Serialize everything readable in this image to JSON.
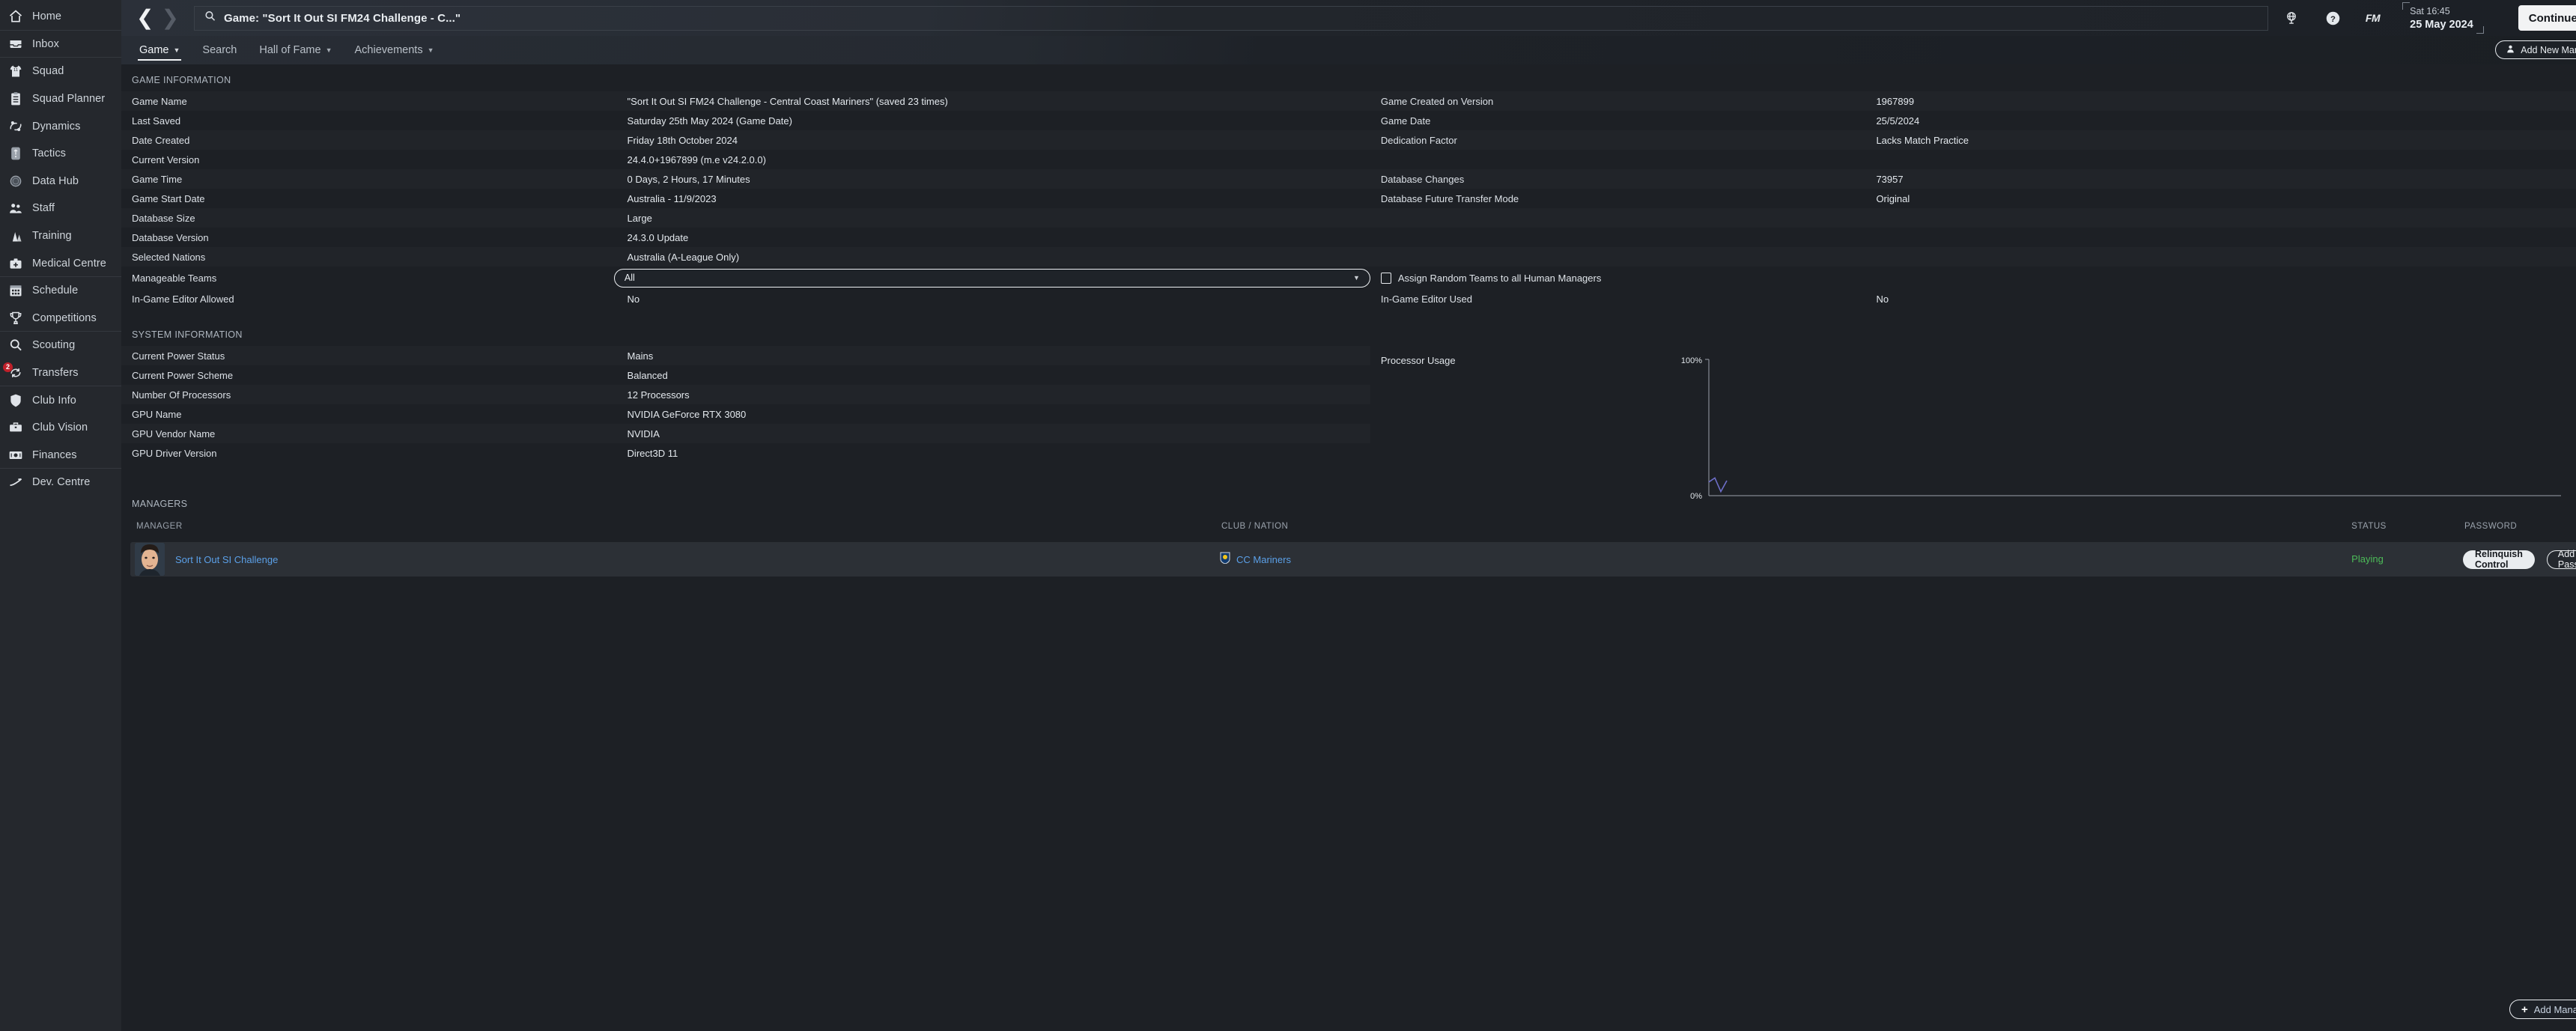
{
  "sidebar": {
    "items": [
      {
        "label": "Home",
        "icon": "home-icon",
        "sep": true
      },
      {
        "label": "Inbox",
        "icon": "inbox-icon",
        "sep": true
      },
      {
        "label": "Squad",
        "icon": "shirt-icon",
        "sep": false
      },
      {
        "label": "Squad Planner",
        "icon": "clipboard-icon",
        "sep": false
      },
      {
        "label": "Dynamics",
        "icon": "dynamics-icon",
        "sep": false
      },
      {
        "label": "Tactics",
        "icon": "tactics-icon",
        "sep": false
      },
      {
        "label": "Data Hub",
        "icon": "datahub-icon",
        "sep": false
      },
      {
        "label": "Staff",
        "icon": "staff-icon",
        "sep": false
      },
      {
        "label": "Training",
        "icon": "training-icon",
        "sep": false
      },
      {
        "label": "Medical Centre",
        "icon": "medical-icon",
        "sep": true
      },
      {
        "label": "Schedule",
        "icon": "calendar-icon",
        "sep": false
      },
      {
        "label": "Competitions",
        "icon": "trophy-icon",
        "sep": true
      },
      {
        "label": "Scouting",
        "icon": "search-icon",
        "sep": false
      },
      {
        "label": "Transfers",
        "icon": "transfers-icon",
        "sep": true,
        "badge": "2"
      },
      {
        "label": "Club Info",
        "icon": "shield-icon",
        "sep": false
      },
      {
        "label": "Club Vision",
        "icon": "briefcase-icon",
        "sep": false
      },
      {
        "label": "Finances",
        "icon": "money-icon",
        "sep": true
      },
      {
        "label": "Dev. Centre",
        "icon": "development-icon",
        "sep": false
      }
    ]
  },
  "header": {
    "title": "Game: \"Sort It Out SI FM24 Challenge - C...\"",
    "clock_time": "Sat 16:45",
    "clock_date": "25 May 2024",
    "fm_logo": "FM",
    "continue_label": "Continue"
  },
  "tabs": [
    {
      "label": "Game",
      "caret": true,
      "active": true
    },
    {
      "label": "Search",
      "caret": false,
      "active": false
    },
    {
      "label": "Hall of Fame",
      "caret": true,
      "active": false
    },
    {
      "label": "Achievements",
      "caret": true,
      "active": false
    }
  ],
  "add_new_manager_label": "Add New Manager",
  "game_information": {
    "heading": "GAME INFORMATION",
    "left_rows": [
      {
        "key": "Game Name",
        "value": "\"Sort It Out SI FM24 Challenge - Central Coast Mariners\" (saved 23 times)"
      },
      {
        "key": "Last Saved",
        "value": "Saturday 25th May 2024 (Game Date)"
      },
      {
        "key": "Date Created",
        "value": "Friday 18th October 2024"
      },
      {
        "key": "Current Version",
        "value": "24.4.0+1967899 (m.e v24.2.0.0)"
      },
      {
        "key": "Game Time",
        "value": "0 Days, 2 Hours, 17 Minutes"
      },
      {
        "key": "Game Start Date",
        "value": "Australia - 11/9/2023"
      },
      {
        "key": "Database Size",
        "value": "Large"
      },
      {
        "key": "Database Version",
        "value": "24.3.0 Update"
      },
      {
        "key": "Selected Nations",
        "value": "Australia (A-League Only)"
      }
    ],
    "right_rows": [
      {
        "key": "Game Created on Version",
        "value": "1967899"
      },
      {
        "key": "Game Date",
        "value": "25/5/2024"
      },
      {
        "key": "Dedication Factor",
        "value": "Lacks Match Practice"
      },
      {
        "key": "",
        "value": ""
      },
      {
        "key": "Database Changes",
        "value": "73957"
      },
      {
        "key": "Database Future Transfer Mode",
        "value": "Original"
      },
      {
        "key": "",
        "value": ""
      },
      {
        "key": "",
        "value": ""
      },
      {
        "key": "",
        "value": ""
      }
    ],
    "manageable_teams_label": "Manageable Teams",
    "manageable_teams_value": "All",
    "assign_random_label": "Assign Random Teams to all Human Managers",
    "assign_random_checked": false,
    "editor_allowed_label": "In-Game Editor Allowed",
    "editor_allowed_value": "No",
    "editor_used_label": "In-Game Editor Used",
    "editor_used_value": "No"
  },
  "system_information": {
    "heading": "SYSTEM INFORMATION",
    "rows": [
      {
        "key": "Current Power Status",
        "value": "Mains"
      },
      {
        "key": "Current Power Scheme",
        "value": "Balanced"
      },
      {
        "key": "Number Of Processors",
        "value": "12 Processors"
      },
      {
        "key": "GPU Name",
        "value": "NVIDIA GeForce RTX 3080"
      },
      {
        "key": "GPU Vendor Name",
        "value": "NVIDIA"
      },
      {
        "key": "GPU Driver Version",
        "value": "Direct3D 11"
      }
    ]
  },
  "chart_data": {
    "type": "line",
    "title": "Processor Usage",
    "ylabel": "",
    "xlabel": "",
    "ylim": [
      0,
      100
    ],
    "ytick_labels": [
      "100%",
      "0%"
    ],
    "yticks": [
      100,
      0
    ],
    "grid": false,
    "legend": false,
    "line_color": "#6d6ec8",
    "series": [
      {
        "name": "Processor Usage",
        "x": [
          0,
          1,
          2,
          3
        ],
        "values": [
          10,
          13,
          3,
          11
        ]
      }
    ]
  },
  "managers": {
    "heading": "MANAGERS",
    "columns": [
      "MANAGER",
      "CLUB / NATION",
      "STATUS",
      "PASSWORD"
    ],
    "rows": [
      {
        "name": "Sort It Out SI Challenge",
        "club": "CC Mariners",
        "status": "Playing",
        "relinquish_label": "Relinquish Control",
        "password_label": "Add Password"
      }
    ],
    "add_manager_label": "Add Manager"
  }
}
